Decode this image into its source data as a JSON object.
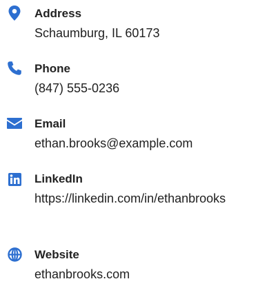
{
  "accent_color": "#2d6fd0",
  "contacts": [
    {
      "label": "Address",
      "value": "Schaumburg, IL 60173",
      "icon": "location-pin-icon"
    },
    {
      "label": "Phone",
      "value": "(847) 555-0236",
      "icon": "phone-icon"
    },
    {
      "label": "Email",
      "value": "ethan.brooks@example.com",
      "icon": "envelope-icon"
    },
    {
      "label": "LinkedIn",
      "value": "https://linkedin.com/in/ethanbrooks",
      "icon": "linkedin-icon"
    },
    {
      "label": "Website",
      "value": "ethanbrooks.com",
      "icon": "globe-icon"
    }
  ]
}
